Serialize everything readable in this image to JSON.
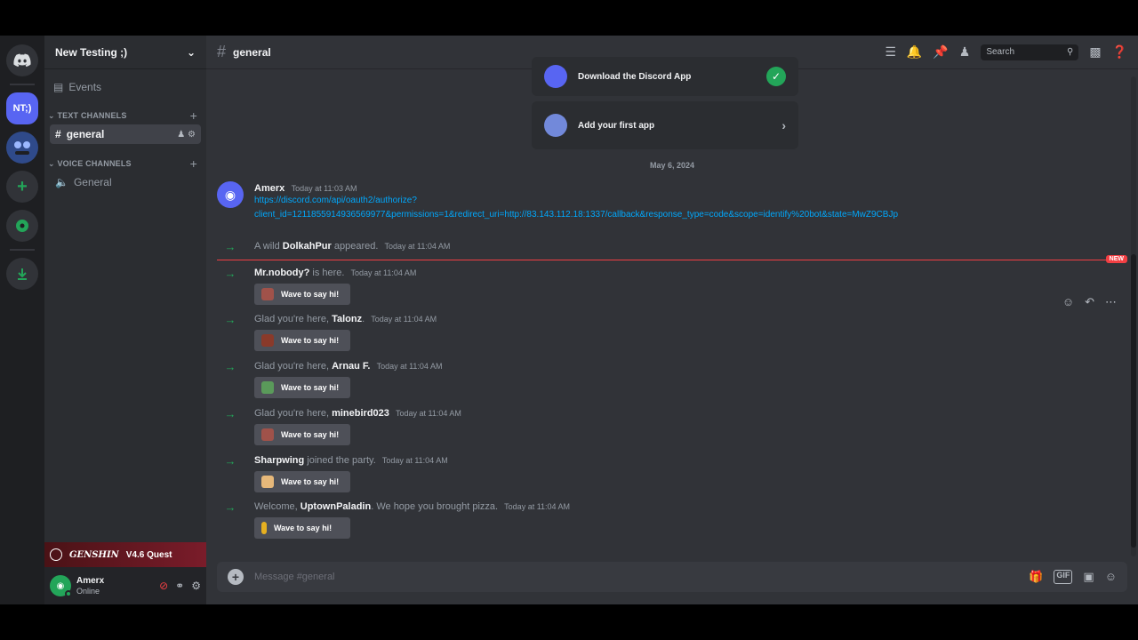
{
  "server_rail": {
    "items": [
      {
        "label": "",
        "icon": "discord-icon"
      },
      {
        "label": "NT;)"
      },
      {
        "label": "",
        "icon": "server-avatar"
      },
      {
        "label": "+",
        "icon": "add-server-icon"
      },
      {
        "label": "",
        "icon": "explore-icon"
      },
      {
        "label": "",
        "icon": "download-icon"
      }
    ]
  },
  "sidebar": {
    "guild_name": "New Testing ;)",
    "events_label": "Events",
    "text_category": "TEXT CHANNELS",
    "voice_category": "VOICE CHANNELS",
    "text_channels": [
      {
        "name": "general"
      }
    ],
    "voice_channels": [
      {
        "name": "General"
      }
    ],
    "quest": {
      "game": "GENSHIN",
      "label": "V4.6 Quest"
    },
    "user": {
      "name": "Amerx",
      "status": "Online"
    }
  },
  "topbar": {
    "channel": "general",
    "search_placeholder": "Search"
  },
  "cards": [
    {
      "label": "Download the Discord App",
      "done": true
    },
    {
      "label": "Add your first app",
      "done": false
    }
  ],
  "date_divider": "May 6, 2024",
  "messages": {
    "amerx": {
      "author": "Amerx",
      "timestamp": "Today at 11:03 AM",
      "link_line1": "https://discord.com/api/oauth2/authorize?",
      "link_line2": "client_id=1211855914936569977&permissions=1&redirect_uri=http://83.143.112.18:1337/callback&response_type=code&scope=identify%20bot&state=MwZ9CBJp"
    },
    "system": [
      {
        "pre": "A wild ",
        "name": "DolkahPur",
        "post": " appeared.",
        "ts": "Today at 11:04 AM"
      },
      {
        "pre": "",
        "name": "Mr.nobody?",
        "post": " is here.",
        "ts": "Today at 11:04 AM"
      },
      {
        "pre": "Glad you're here, ",
        "name": "Talonz",
        "post": ".",
        "ts": "Today at 11:04 AM"
      },
      {
        "pre": "Glad you're here, ",
        "name": "Arnau F.",
        "post": "",
        "ts": "Today at 11:04 AM"
      },
      {
        "pre": "Glad you're here, ",
        "name": "minebird023",
        "post": "",
        "ts": "Today at 11:04 AM"
      },
      {
        "pre": "",
        "name": "Sharpwing",
        "post": " joined the party.",
        "ts": "Today at 11:04 AM"
      },
      {
        "pre": "Welcome, ",
        "name": "UptownPaladin",
        "post": ". We hope you brought pizza.",
        "ts": "Today at 11:04 AM"
      }
    ],
    "wave_label": "Wave to say hi!",
    "new_tag": "NEW"
  },
  "composer": {
    "placeholder": "Message #general"
  },
  "colors": {
    "accent": "#5865f2",
    "online": "#23a559",
    "link": "#00a8fc",
    "new": "#f23f43"
  }
}
